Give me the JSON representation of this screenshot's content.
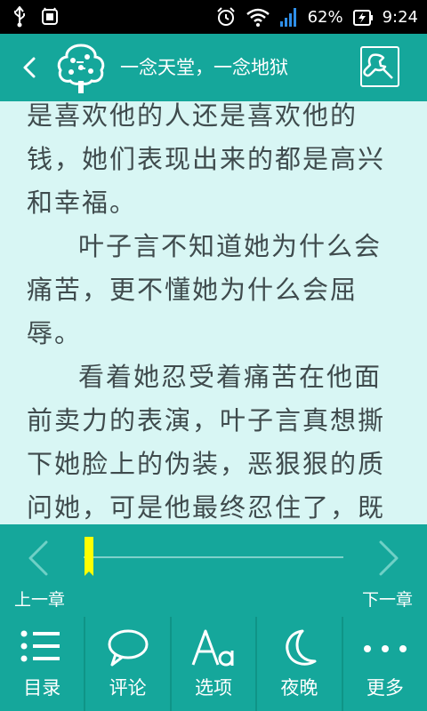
{
  "status": {
    "battery": "62%",
    "time": "9:24"
  },
  "header": {
    "title": "一念天堂，一念地狱"
  },
  "content": {
    "paragraphs": [
      {
        "text": "是喜欢他的人还是喜欢他的钱，她们表现出来的都是高兴和幸福。",
        "indent": false
      },
      {
        "text": "叶子言不知道她为什么会痛苦，更不懂她为什么会屈辱。",
        "indent": true
      },
      {
        "text": "看着她忍受着痛苦在他面前卖力的表演，叶子言真想撕下她脸上的伪装，恶狠狠的质问她，可是他最终忍住了，既然她喜欢装，他就奉陪到底。",
        "indent": true
      }
    ]
  },
  "progress": {
    "prev_label": "上一章",
    "next_label": "下一章",
    "position": 0.02
  },
  "toolbar": {
    "items": [
      {
        "label": "目录",
        "icon": "list-icon"
      },
      {
        "label": "评论",
        "icon": "comment-icon"
      },
      {
        "label": "选项",
        "icon": "font-icon"
      },
      {
        "label": "夜晚",
        "icon": "moon-icon"
      },
      {
        "label": "更多",
        "icon": "more-icon"
      }
    ]
  },
  "colors": {
    "accent": "#15a79b",
    "page_background": "#d8f6f4",
    "text": "#3f4b4d",
    "progress_thumb": "#ffff00"
  }
}
